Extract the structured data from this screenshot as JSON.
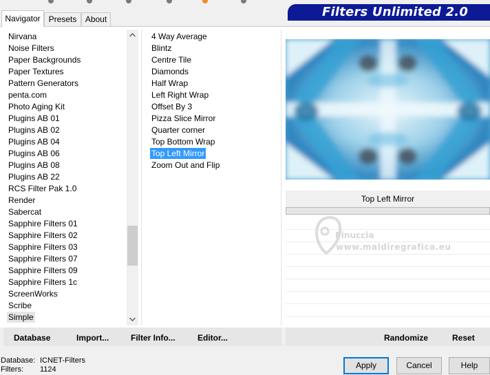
{
  "tabs": [
    {
      "label": "Navigator"
    },
    {
      "label": "Presets"
    },
    {
      "label": "About"
    }
  ],
  "banner": {
    "title": "Filters Unlimited 2.0",
    "color": "#0c1a96"
  },
  "categories": {
    "items": [
      "Nirvana",
      "Noise Filters",
      "Paper Backgrounds",
      "Paper Textures",
      "Pattern Generators",
      "penta.com",
      "Photo Aging Kit",
      "Plugins AB 01",
      "Plugins AB 02",
      "Plugins AB 04",
      "Plugins AB 06",
      "Plugins AB 08",
      "Plugins AB 22",
      "RCS Filter Pak 1.0",
      "Render",
      "Sabercat",
      "Sapphire Filters 01",
      "Sapphire Filters 02",
      "Sapphire Filters 03",
      "Sapphire Filters 07",
      "Sapphire Filters 09",
      "Sapphire Filters 1c",
      "ScreenWorks",
      "Scribe",
      "Simple"
    ],
    "selected": "Simple"
  },
  "filters": {
    "items": [
      "4 Way Average",
      "Blintz",
      "Centre Tile",
      "Diamonds",
      "Half Wrap",
      "Left Right Wrap",
      "Offset By 3",
      "Pizza Slice Mirror",
      "Quarter corner",
      "Top Bottom Wrap",
      "Top Left Mirror",
      "Zoom Out and Flip"
    ],
    "selected": "Top Left Mirror",
    "selected_color": "#3399ff"
  },
  "preview": {
    "filter_name": "Top Left Mirror"
  },
  "watermark": {
    "name": "Pinuccia",
    "url": "www.maldiregrafica.eu"
  },
  "commands_left": {
    "database": "Database",
    "import": "Import...",
    "filter_info": "Filter Info...",
    "editor": "Editor..."
  },
  "commands_right": {
    "randomize": "Randomize",
    "reset": "Reset"
  },
  "status": {
    "database_label": "Database:",
    "database_value": "ICNET-Filters",
    "filters_label": "Filters:",
    "filters_value": "1124"
  },
  "buttons": {
    "apply": "Apply",
    "cancel": "Cancel",
    "help": "Help"
  },
  "icons": {
    "scroll_up": "chevron-up-icon",
    "scroll_down": "chevron-down-icon"
  }
}
